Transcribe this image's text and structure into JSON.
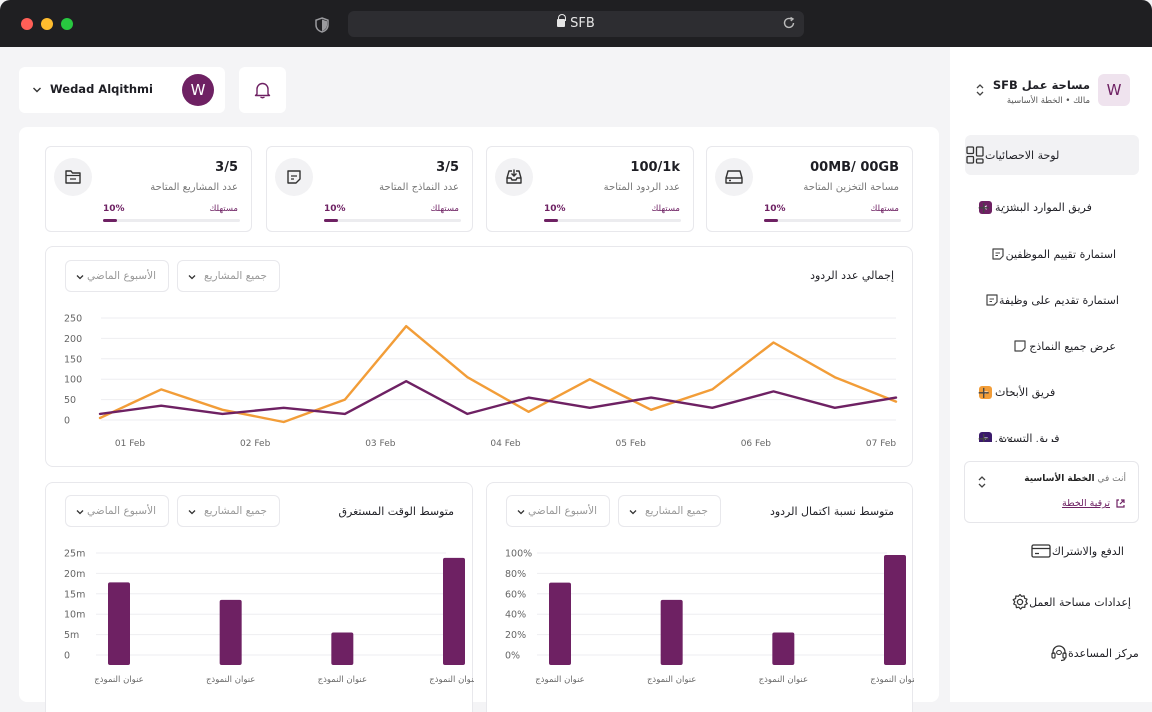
{
  "browser": {
    "url": "SFB"
  },
  "workspace": {
    "avatar_letter": "W",
    "title": "مساحة عمل SFB",
    "subtitle": "مالك • الخطة الأساسية"
  },
  "sidebar": {
    "dashboard": "لوحة الاحصائيات",
    "team_hr": "فريق الموارد البشرية",
    "form_employee_eval": "استمارة تقييم الموظفين",
    "form_job_apply": "استمارة تقديم على وظيفة",
    "all_forms": "عرض جميع النماذج",
    "team_research": "فريق الأبحاث",
    "team_marketing": "فريق التسويق",
    "more": "···",
    "add": "+",
    "plan_prefix": "أنت في",
    "plan_name": "الخطة الأساسية",
    "upgrade_link": "ترقية الخطة",
    "billing": "الدفع والاشتراك",
    "workspace_settings": "إعدادات مساحة العمل",
    "help_center": "مركز المساعدة"
  },
  "user": {
    "name": "Wedad Alqithmi",
    "avatar_letter": "W"
  },
  "stats": [
    {
      "value": "00MB/ 00GB",
      "label": "مساحة التخزين المتاحة",
      "usage_label": "مستهلك",
      "percent": "10%",
      "fill": 0.1
    },
    {
      "value": "100/1k",
      "label": "عدد الردود المتاحة",
      "usage_label": "مستهلك",
      "percent": "10%",
      "fill": 0.1
    },
    {
      "value": "3/5",
      "label": "عدد النماذج المتاحة",
      "usage_label": "مستهلك",
      "percent": "10%",
      "fill": 0.1
    },
    {
      "value": "3/5",
      "label": "عدد المشاريع المتاحة",
      "usage_label": "مستهلك",
      "percent": "10%",
      "fill": 0.1
    }
  ],
  "filters": {
    "projects": "جميع المشاريع",
    "period": "الأسبوع الماضي"
  },
  "colors": {
    "primary": "#6e2163",
    "orange": "#f29d38",
    "team_hr": "#6e2163",
    "team_research": "#f29d38",
    "team_marketing": "#3b1a6b"
  },
  "chart_data": [
    {
      "type": "line",
      "title": "إجمالي عدد الردود",
      "x": [
        "01 Feb",
        "",
        "02 Feb",
        "",
        "03 Feb",
        "",
        "04 Feb",
        "",
        "05 Feb",
        "",
        "06 Feb",
        "",
        "07 Feb",
        ""
      ],
      "x_ticks": [
        "01 Feb",
        "02 Feb",
        "03 Feb",
        "04 Feb",
        "05 Feb",
        "06 Feb",
        "07 Feb"
      ],
      "y_ticks": [
        "0",
        "50",
        "100",
        "150",
        "200",
        "250"
      ],
      "ylim": [
        0,
        250
      ],
      "grid": true,
      "series": [
        {
          "color": "#f29d38",
          "values": [
            5,
            75,
            25,
            -5,
            50,
            230,
            105,
            20,
            100,
            25,
            75,
            190,
            105,
            45
          ]
        },
        {
          "color": "#6e2163",
          "values": [
            15,
            35,
            15,
            30,
            15,
            95,
            15,
            55,
            30,
            55,
            30,
            70,
            30,
            55
          ]
        }
      ]
    },
    {
      "type": "bar",
      "title": "متوسط نسبة اكتمال الردود",
      "categories": [
        "عنوان النموذج",
        "عنوان النموذج",
        "عنوان النموذج",
        "عنوان النموذج"
      ],
      "values": [
        71,
        54,
        22,
        98
      ],
      "y_ticks": [
        "0%",
        "20%",
        "40%",
        "60%",
        "80%",
        "100%"
      ],
      "ylim": [
        0,
        100
      ],
      "grid": true
    },
    {
      "type": "bar",
      "title": "متوسط الوقت المستغرق",
      "categories": [
        "عنوان النموذج",
        "عنوان النموذج",
        "عنوان النموذج",
        "عنوان النموذج"
      ],
      "values": [
        17.8,
        13.5,
        5.5,
        23.8
      ],
      "y_ticks": [
        "0",
        "5m",
        "10m",
        "15m",
        "20m",
        "25m"
      ],
      "ylim": [
        0,
        25
      ],
      "grid": true
    }
  ]
}
